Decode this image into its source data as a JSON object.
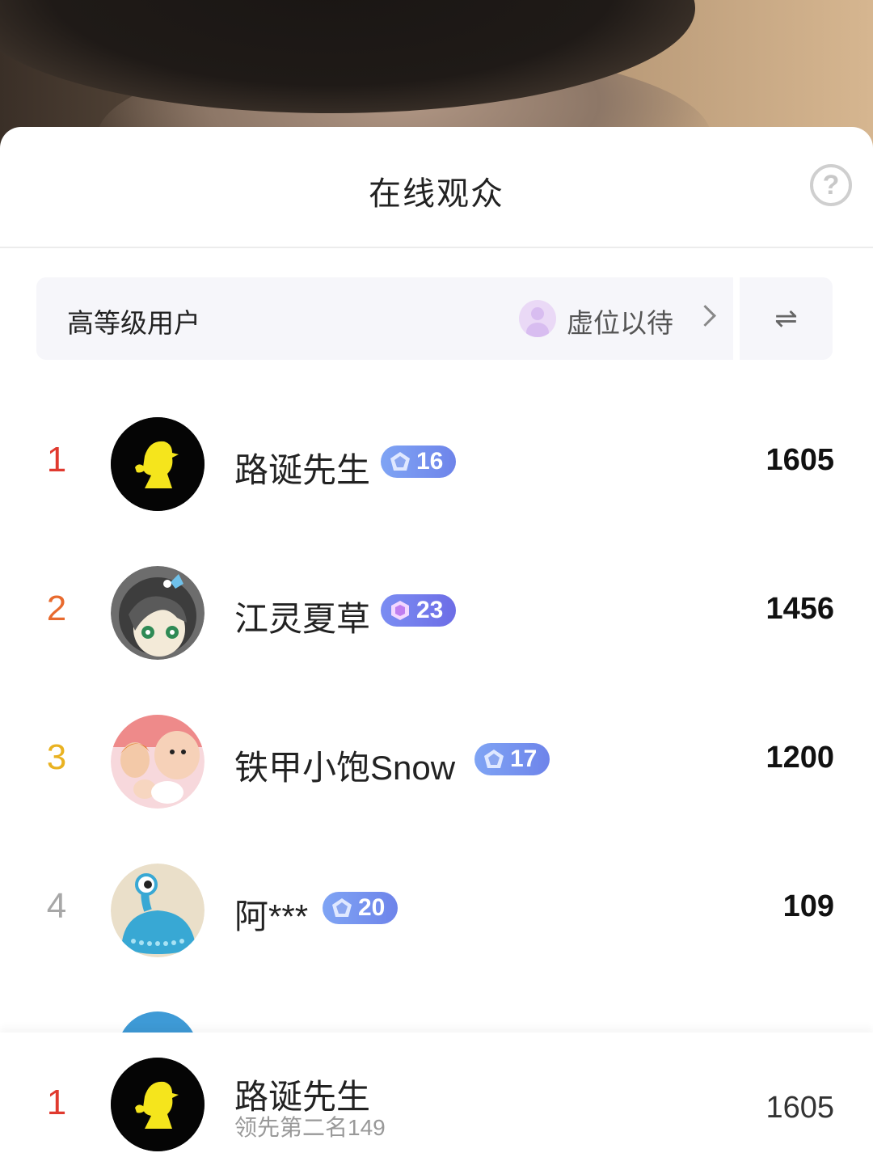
{
  "header": {
    "title": "在线观众",
    "help_label": "?"
  },
  "level_bar": {
    "label": "高等级用户",
    "link_label": "虚位以待",
    "switch_label": "⇌"
  },
  "viewers": [
    {
      "rank": "1",
      "name": "路诞先生",
      "level": "16",
      "score": "1605",
      "rank_color": "#e03a2f"
    },
    {
      "rank": "2",
      "name": "江灵夏草",
      "level": "23",
      "score": "1456",
      "rank_color": "#e86a2e"
    },
    {
      "rank": "3",
      "name": "铁甲小饱Snow",
      "level": "17",
      "score": "1200",
      "rank_color": "#e9b221"
    },
    {
      "rank": "4",
      "name": "阿***",
      "level": "20",
      "score": "109",
      "rank_color": "#a7a7a7"
    }
  ],
  "me": {
    "rank": "1",
    "name": "路诞先生",
    "sub": "领先第二名149",
    "score": "1605"
  },
  "icons": {
    "help": "question-circle-icon",
    "switch": "swap-arrows-icon",
    "chevron": "chevron-right-icon"
  },
  "colors": {
    "badge_start": "#7fa4f4",
    "badge_end": "#6e84ea",
    "panel_bg": "#f6f6fa"
  }
}
